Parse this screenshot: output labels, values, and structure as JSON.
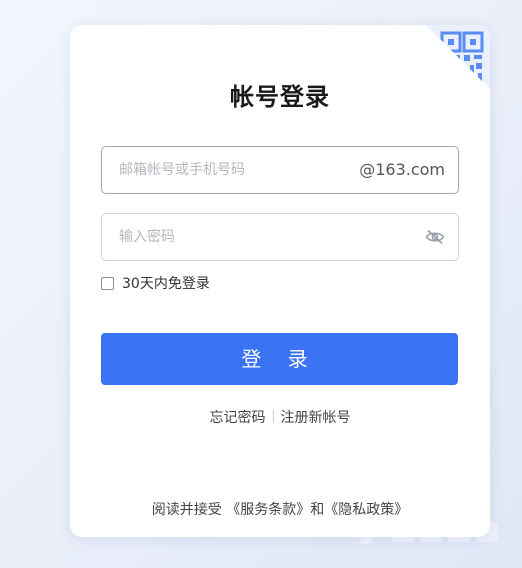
{
  "login_card": {
    "title": "帐号登录",
    "email_field": {
      "placeholder": "邮箱帐号或手机号码",
      "value": "",
      "suffix": "@163.com"
    },
    "password_field": {
      "placeholder": "输入密码",
      "value": "",
      "toggle_icon": "eye-slash-icon"
    },
    "remember": {
      "label": "30天内免登录",
      "checked": false
    },
    "login_button": "登 录",
    "links": {
      "forgot_password": "忘记密码",
      "register": "注册新帐号"
    },
    "terms": {
      "prefix": "阅读并接受",
      "service_terms": "《服务条款》",
      "conjunction": "和",
      "privacy_policy": "《隐私政策》"
    },
    "qr_icon": "qr-code-icon"
  },
  "colors": {
    "primary": "#3a74f5",
    "qr_accent": "#5b8cf2"
  }
}
